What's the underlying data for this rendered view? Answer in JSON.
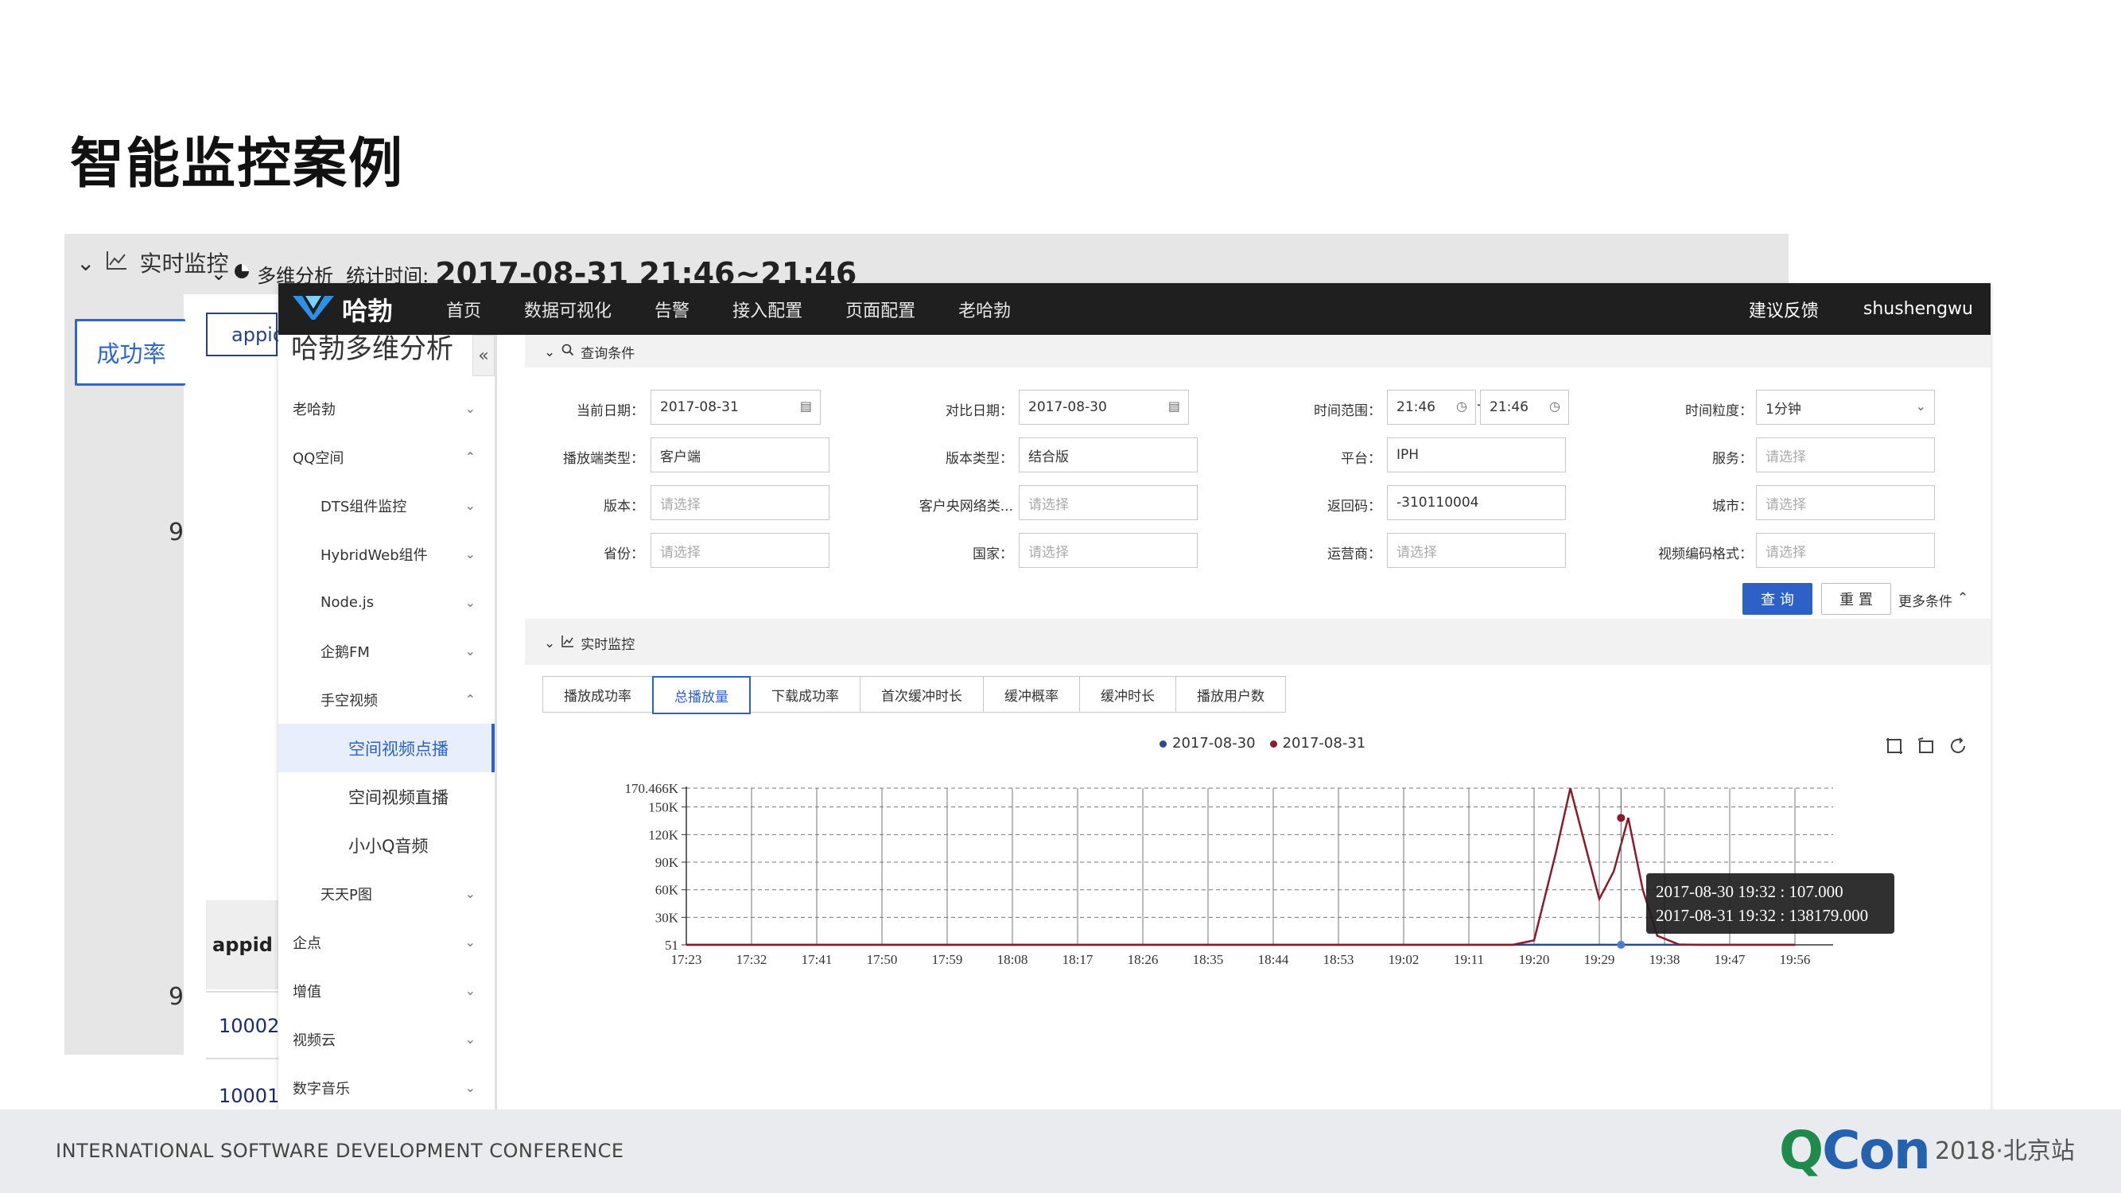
{
  "slide": {
    "title": "智能监控案例",
    "footer": "INTERNATIONAL SOFTWARE DEVELOPMENT CONFERENCE",
    "brand": {
      "q": "Q",
      "con": "Con",
      "sub": "2018·北京站"
    }
  },
  "background_window": {
    "header_label": "实时监控",
    "section_label": "多维分析",
    "stat_label": "统计时间:",
    "stat_time": "2017-08-31 21:46~21:46",
    "tab_success": "成功率",
    "appid_top": "appid",
    "appid_row": "appid",
    "num_9a": "9",
    "num_9b": "9",
    "val1": "10002",
    "val2": "10001"
  },
  "topbar": {
    "logo_text": "哈勃",
    "nav": [
      "首页",
      "数据可视化",
      "告警",
      "接入配置",
      "页面配置",
      "老哈勃"
    ],
    "feedback": "建议反馈",
    "user": "shushengwu"
  },
  "sidebar": {
    "title": "哈勃多维分析",
    "collapse": "«",
    "items": [
      {
        "label": "老哈勃",
        "chev": "⌄"
      },
      {
        "label": "QQ空间",
        "chev": "⌃"
      },
      {
        "label": "DTS组件监控",
        "chev": "⌄"
      },
      {
        "label": "HybridWeb组件",
        "chev": "⌄"
      },
      {
        "label": "Node.js",
        "chev": "⌄"
      },
      {
        "label": "企鹅FM",
        "chev": "⌄"
      },
      {
        "label": "手空视频",
        "chev": "⌃"
      },
      {
        "label": "空间视频点播",
        "chev": ""
      },
      {
        "label": "空间视频直播",
        "chev": ""
      },
      {
        "label": "小小Q音频",
        "chev": ""
      },
      {
        "label": "天天P图",
        "chev": "⌄"
      },
      {
        "label": "企点",
        "chev": "⌄"
      },
      {
        "label": "增值",
        "chev": "⌄"
      },
      {
        "label": "视频云",
        "chev": "⌄"
      },
      {
        "label": "数字音乐",
        "chev": "⌄"
      }
    ]
  },
  "query": {
    "title": "查询条件",
    "fields": [
      {
        "label": "当前日期：",
        "value": "2017-08-31",
        "placeholder": ""
      },
      {
        "label": "对比日期：",
        "value": "2017-08-30",
        "placeholder": ""
      },
      {
        "label": "时间范围：",
        "value": "21:46",
        "value2": "21:46"
      },
      {
        "label": "时间粒度：",
        "value": "1分钟",
        "placeholder": ""
      },
      {
        "label": "播放端类型：",
        "value": "客户端",
        "placeholder": ""
      },
      {
        "label": "版本类型：",
        "value": "结合版",
        "placeholder": ""
      },
      {
        "label": "平台：",
        "value": "IPH",
        "placeholder": ""
      },
      {
        "label": "服务：",
        "value": "",
        "placeholder": "请选择"
      },
      {
        "label": "版本：",
        "value": "",
        "placeholder": "请选择"
      },
      {
        "label": "客户央网络类...",
        "value": "",
        "placeholder": "请选择"
      },
      {
        "label": "返回码：",
        "value": "-310110004",
        "placeholder": ""
      },
      {
        "label": "城市：",
        "value": "",
        "placeholder": "请选择"
      },
      {
        "label": "省份：",
        "value": "",
        "placeholder": "请选择"
      },
      {
        "label": "国家：",
        "value": "",
        "placeholder": "请选择"
      },
      {
        "label": "运营商：",
        "value": "",
        "placeholder": "请选择"
      },
      {
        "label": "视频编码格式：",
        "value": "",
        "placeholder": "请选择"
      }
    ],
    "query_btn": "查 询",
    "reset_btn": "重 置",
    "more": "更多条件"
  },
  "monitor": {
    "title": "实时监控",
    "tabs": [
      "播放成功率",
      "总播放量",
      "下载成功率",
      "首次缓冲时长",
      "缓冲概率",
      "缓冲时长",
      "播放用户数"
    ],
    "active_tab": 1
  },
  "chart_data": {
    "type": "line",
    "legend": [
      "2017-08-30",
      "2017-08-31"
    ],
    "colors": {
      "2017-08-30": "#2b4a8a",
      "2017-08-31": "#8b1a2a"
    },
    "x": [
      "17:23",
      "17:32",
      "17:41",
      "17:50",
      "17:59",
      "18:08",
      "18:17",
      "18:26",
      "18:35",
      "18:44",
      "18:53",
      "19:02",
      "19:11",
      "19:20",
      "19:29",
      "19:38",
      "19:47",
      "19:56"
    ],
    "y_ticks": [
      "51",
      "30K",
      "60K",
      "90K",
      "120K",
      "150K",
      "170.466K"
    ],
    "y_tick_values": [
      51,
      30000,
      60000,
      90000,
      120000,
      150000,
      170466
    ],
    "ylim": [
      51,
      170466
    ],
    "x_minutes_range": [
      0,
      153
    ],
    "series": [
      {
        "name": "2017-08-30",
        "points": [
          [
            0,
            107
          ],
          [
            153,
            107
          ]
        ]
      },
      {
        "name": "2017-08-31",
        "points": [
          [
            0,
            51
          ],
          [
            114,
            51
          ],
          [
            117,
            5000
          ],
          [
            120,
            100000
          ],
          [
            122,
            170466
          ],
          [
            124,
            110000
          ],
          [
            126,
            50000
          ],
          [
            128,
            80000
          ],
          [
            130,
            138179
          ],
          [
            132,
            60000
          ],
          [
            134,
            10000
          ],
          [
            137,
            500
          ],
          [
            140,
            51
          ],
          [
            153,
            51
          ]
        ]
      }
    ],
    "tooltip": [
      "2017-08-30 19:32 : 107.000",
      "2017-08-31 19:32 : 138179.000"
    ]
  }
}
